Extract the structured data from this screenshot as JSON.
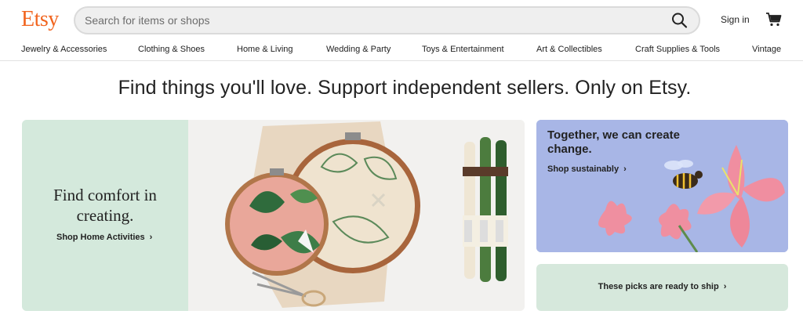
{
  "header": {
    "logo": "Etsy",
    "search_placeholder": "Search for items or shops",
    "search_icon": "search-icon",
    "signin_label": "Sign in",
    "cart_icon": "cart-icon"
  },
  "nav": {
    "items": [
      "Jewelry & Accessories",
      "Clothing & Shoes",
      "Home & Living",
      "Wedding & Party",
      "Toys & Entertainment",
      "Art & Collectibles",
      "Craft Supplies & Tools",
      "Vintage"
    ]
  },
  "tagline": "Find things you'll love. Support independent sellers. Only on Etsy.",
  "hero": {
    "left": {
      "title": "Find comfort in creating.",
      "link": "Shop Home Activities"
    },
    "right_top": {
      "title": "Together, we can create change.",
      "link": "Shop sustainably"
    },
    "right_bottom": {
      "link": "These picks are ready to ship"
    },
    "chevron": "›"
  },
  "colors": {
    "brand": "#f1641e",
    "mint": "#d4e9dc",
    "periwinkle": "#a9b8e8"
  }
}
